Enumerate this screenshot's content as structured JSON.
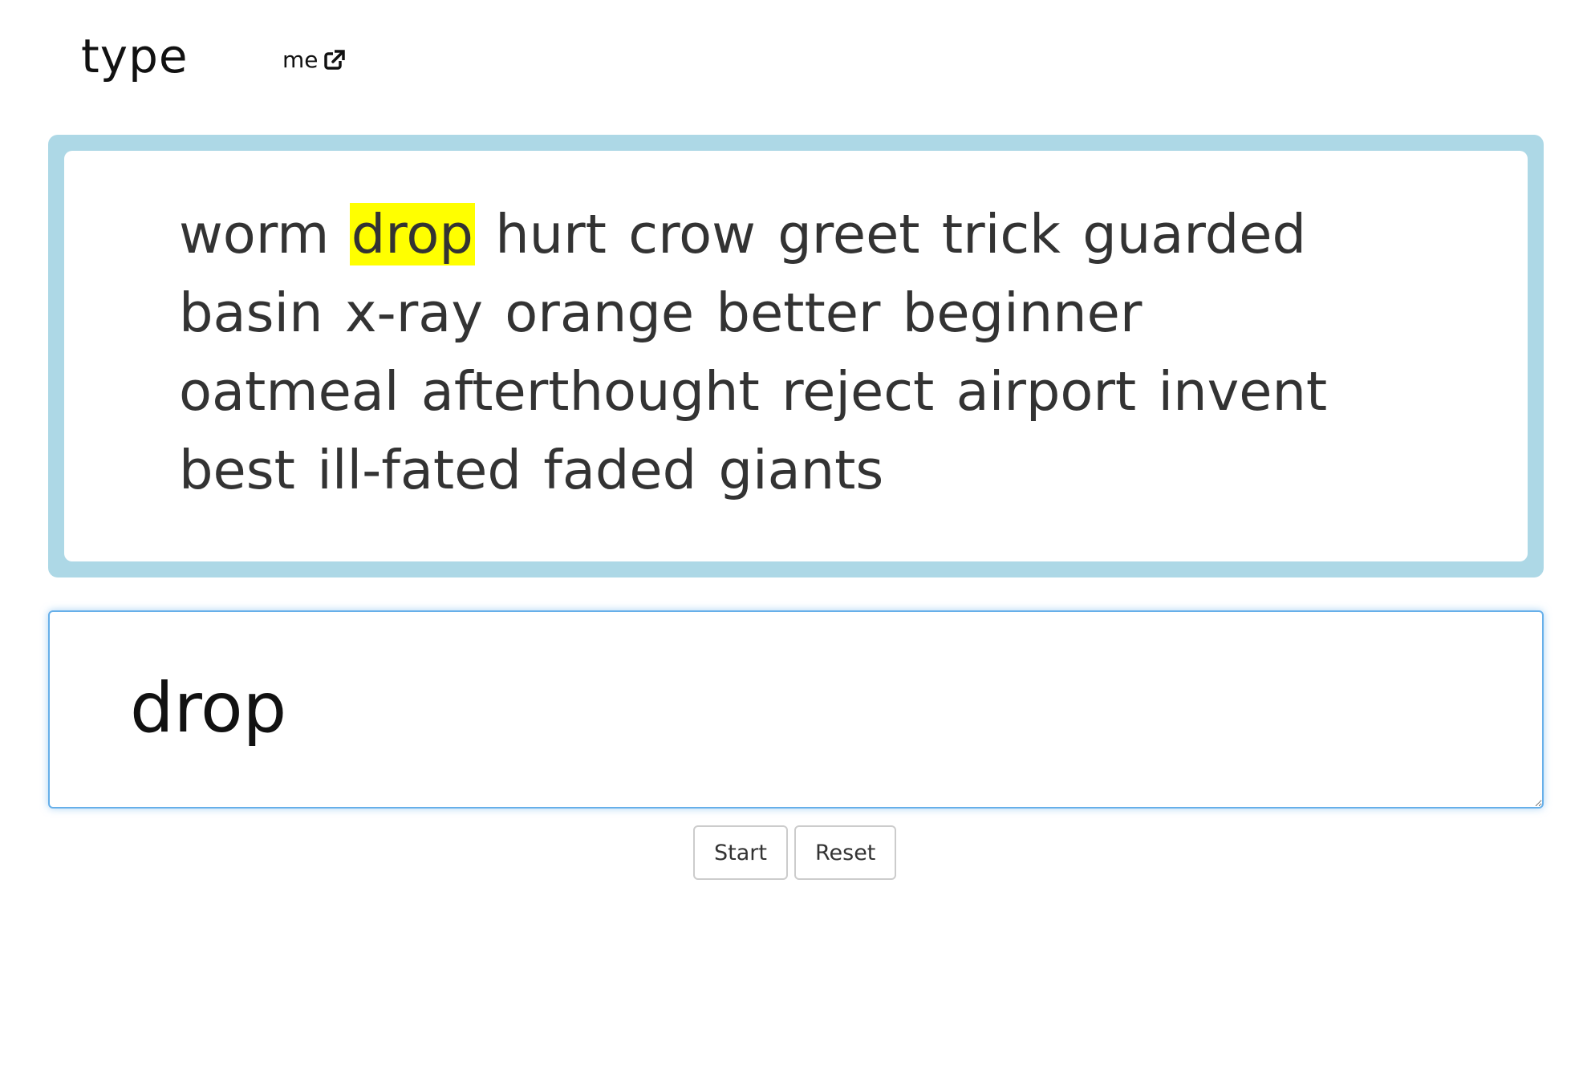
{
  "navbar": {
    "brand": "type",
    "link_label": "me",
    "link_icon": "external-link-icon"
  },
  "words": {
    "items": [
      "worm",
      "drop",
      "hurt",
      "crow",
      "greet",
      "trick",
      "guarded",
      "basin",
      "x-ray",
      "orange",
      "better",
      "beginner",
      "oatmeal",
      "afterthought",
      "reject",
      "airport",
      "invent",
      "best",
      "ill-fated",
      "faded",
      "giants"
    ],
    "current_index": 1,
    "highlight_color": "#ffff00",
    "panel_border_color": "#add8e6"
  },
  "input": {
    "value": "drop",
    "focus_color": "#66afe9"
  },
  "controls": {
    "start_label": "Start",
    "reset_label": "Reset"
  }
}
